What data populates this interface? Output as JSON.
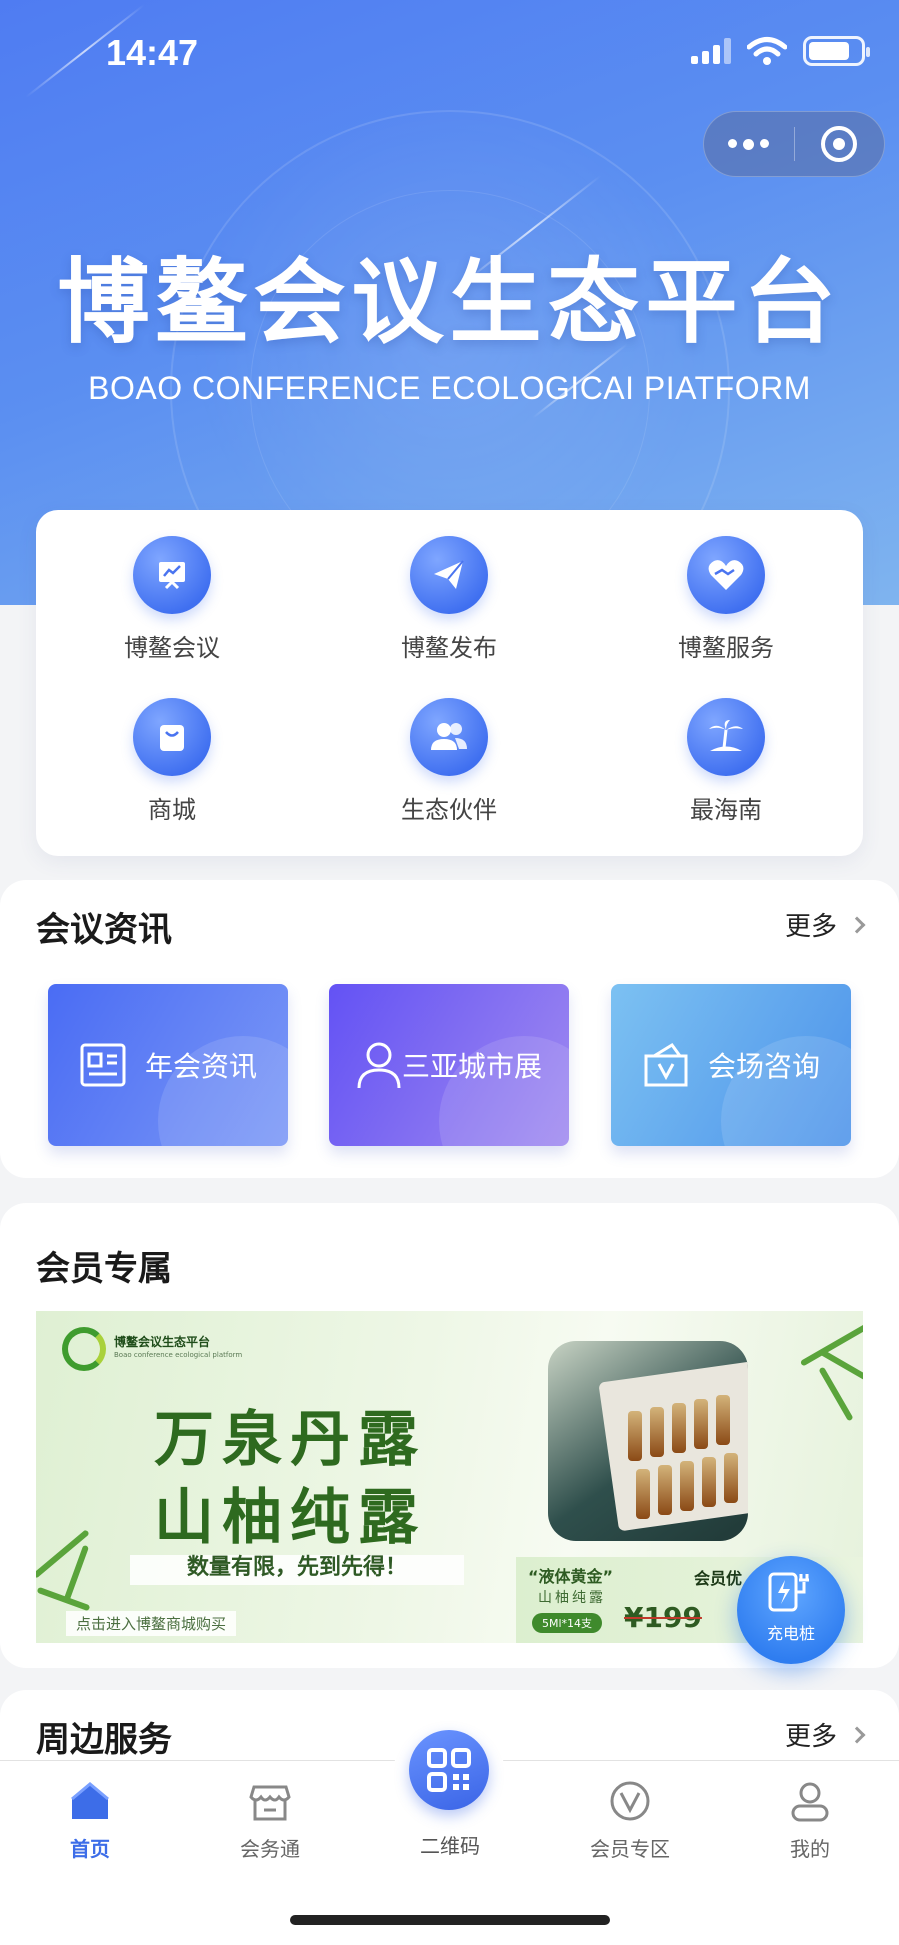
{
  "status_bar": {
    "time": "14:47"
  },
  "hero": {
    "title": "博鳌会议生态平台",
    "subtitle": "BOAO CONFERENCE ECOLOGICAI PIATFORM"
  },
  "quick_menu": [
    {
      "label": "博鳌会议",
      "icon": "presentation-chart-icon"
    },
    {
      "label": "博鳌发布",
      "icon": "paper-plane-icon"
    },
    {
      "label": "博鳌服务",
      "icon": "heart-hand-icon"
    },
    {
      "label": "商城",
      "icon": "shopping-bag-icon"
    },
    {
      "label": "生态伙伴",
      "icon": "users-icon"
    },
    {
      "label": "最海南",
      "icon": "palm-island-icon"
    }
  ],
  "news": {
    "title": "会议资讯",
    "more": "更多",
    "tiles": [
      {
        "label": "年会资讯",
        "icon": "newspaper-icon",
        "color_from": "#4a6cf4",
        "color_to": "#6f8ff6"
      },
      {
        "label": "三亚城市展",
        "icon": "person-icon",
        "color_from": "#6a5cf5",
        "color_to": "#9a7ff0"
      },
      {
        "label": "会场咨询",
        "icon": "bag-v-icon",
        "color_from": "#6eb3ef",
        "color_to": "#4f97ea"
      }
    ]
  },
  "member": {
    "title": "会员专属",
    "banner": {
      "brand": "博鳌会议生态平台",
      "brand_en": "Boao conference ecological platform",
      "line1": "万泉丹露",
      "line2": "山柚纯露",
      "slogan": "数量有限，先到先得！",
      "buy_hint": "点击进入博鳌商城购买",
      "gold_title": "“液体黄金”",
      "gold_sub": "山柚纯露",
      "spec": "5Ml*14支",
      "member_tag": "会员优",
      "price": "¥199",
      "price_new": "¥"
    }
  },
  "charger": {
    "label": "充电桩"
  },
  "nearby": {
    "title": "周边服务",
    "more": "更多"
  },
  "tabbar": {
    "accent": "#3d6de8",
    "items": [
      {
        "label": "首页",
        "icon": "home-icon",
        "active": true
      },
      {
        "label": "会务通",
        "icon": "store-icon",
        "active": false
      },
      {
        "label": "二维码",
        "icon": "qr-code-icon",
        "active": false
      },
      {
        "label": "会员专区",
        "icon": "vip-icon",
        "active": false
      },
      {
        "label": "我的",
        "icon": "user-icon",
        "active": false
      }
    ]
  }
}
